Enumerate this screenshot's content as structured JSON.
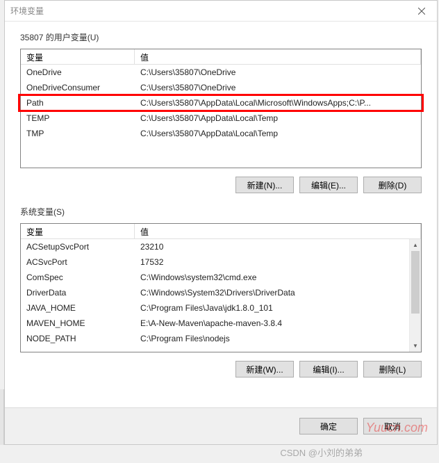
{
  "dialog": {
    "title": "环境变量"
  },
  "user_section": {
    "label": "35807 的用户变量(U)",
    "headers": {
      "var": "变量",
      "val": "值"
    },
    "rows": [
      {
        "var": "OneDrive",
        "val": "C:\\Users\\35807\\OneDrive"
      },
      {
        "var": "OneDriveConsumer",
        "val": "C:\\Users\\35807\\OneDrive"
      },
      {
        "var": "Path",
        "val": "C:\\Users\\35807\\AppData\\Local\\Microsoft\\WindowsApps;C:\\P..."
      },
      {
        "var": "TEMP",
        "val": "C:\\Users\\35807\\AppData\\Local\\Temp"
      },
      {
        "var": "TMP",
        "val": "C:\\Users\\35807\\AppData\\Local\\Temp"
      }
    ],
    "buttons": {
      "new": "新建(N)...",
      "edit": "编辑(E)...",
      "delete": "删除(D)"
    }
  },
  "system_section": {
    "label": "系统变量(S)",
    "headers": {
      "var": "变量",
      "val": "值"
    },
    "rows": [
      {
        "var": "ACSetupSvcPort",
        "val": "23210"
      },
      {
        "var": "ACSvcPort",
        "val": "17532"
      },
      {
        "var": "ComSpec",
        "val": "C:\\Windows\\system32\\cmd.exe"
      },
      {
        "var": "DriverData",
        "val": "C:\\Windows\\System32\\Drivers\\DriverData"
      },
      {
        "var": "JAVA_HOME",
        "val": "C:\\Program Files\\Java\\jdk1.8.0_101"
      },
      {
        "var": "MAVEN_HOME",
        "val": "E:\\A-New-Maven\\apache-maven-3.8.4"
      },
      {
        "var": "NODE_PATH",
        "val": "C:\\Program Files\\nodejs"
      }
    ],
    "buttons": {
      "new": "新建(W)...",
      "edit": "编辑(I)...",
      "delete": "删除(L)"
    }
  },
  "footer": {
    "ok": "确定",
    "cancel": "取消"
  },
  "watermarks": {
    "w1": "Yuucn.com",
    "w2": "CSDN @小刘的弟弟"
  },
  "arrows": {
    "up": "▲",
    "down": "▼"
  }
}
